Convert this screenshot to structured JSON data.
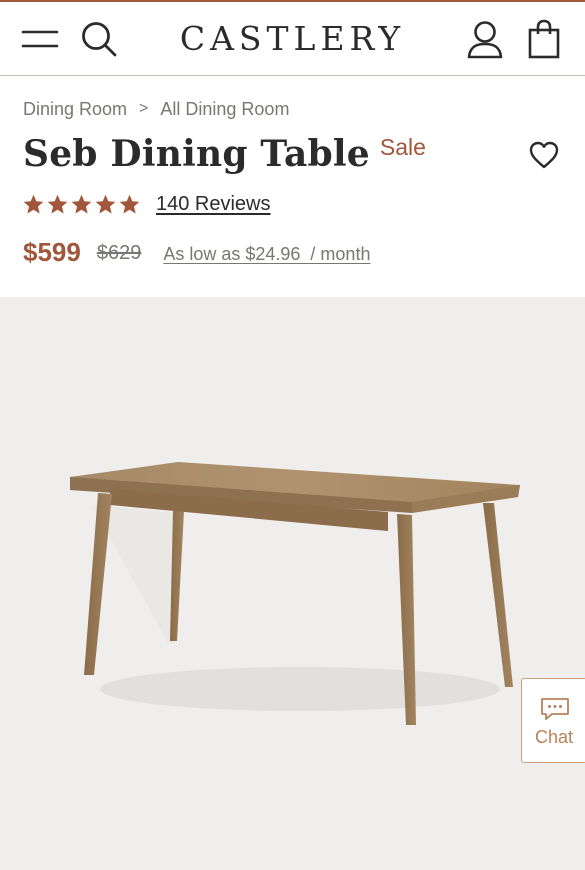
{
  "brand": {
    "logo_text": "CASTLERY",
    "accent_color": "#a0573a"
  },
  "header": {
    "menu_icon": "hamburger-menu-icon",
    "search_icon": "search-icon",
    "account_icon": "user-account-icon",
    "bag_icon": "shopping-bag-icon"
  },
  "breadcrumb": {
    "items": [
      "Dining Room",
      "All Dining Room"
    ],
    "separator": ">"
  },
  "product": {
    "title": "Seb Dining Table",
    "sale_badge": "Sale",
    "rating": 5,
    "rating_max": 5,
    "reviews_label": "140 Reviews",
    "price": "$599",
    "original_price": "$629",
    "finance_label": "As low as $24.96  / month"
  },
  "chat": {
    "label": "Chat",
    "icon": "chat-bubble-icon"
  },
  "image": {
    "subject": "wooden-dining-table",
    "background_color": "#efeeec"
  }
}
